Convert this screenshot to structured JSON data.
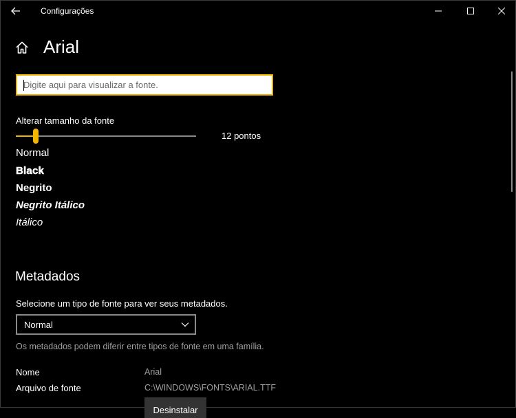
{
  "window": {
    "title": "Configurações"
  },
  "header": {
    "title": "Arial"
  },
  "preview": {
    "placeholder": "Digite aqui para visualizar a fonte."
  },
  "size": {
    "label": "Alterar tamanho da fonte",
    "value_text": "12 pontos",
    "value": 12,
    "min": 1,
    "max": 100
  },
  "styles": [
    "Normal",
    "Black",
    "Negrito",
    "Negrito Itálico",
    "Itálico"
  ],
  "metadata": {
    "title": "Metadados",
    "instruction": "Selecione um tipo de fonte para ver seus metadados.",
    "selected": "Normal",
    "note": "Os metadados podem diferir entre tipos de fonte em uma família.",
    "name_label": "Nome",
    "name_value": "Arial",
    "file_label": "Arquivo de fonte",
    "file_value": "C:\\WINDOWS\\FONTS\\ARIAL.TTF",
    "uninstall_label": "Desinstalar"
  },
  "colors": {
    "accent": "#f2b600",
    "background": "#000000",
    "secondary_text": "#a0a0a0"
  },
  "icons": {
    "back": "back-arrow-icon",
    "home": "home-icon",
    "minimize": "minimize-icon",
    "maximize": "maximize-icon",
    "close": "close-icon",
    "chevron": "chevron-down-icon"
  }
}
